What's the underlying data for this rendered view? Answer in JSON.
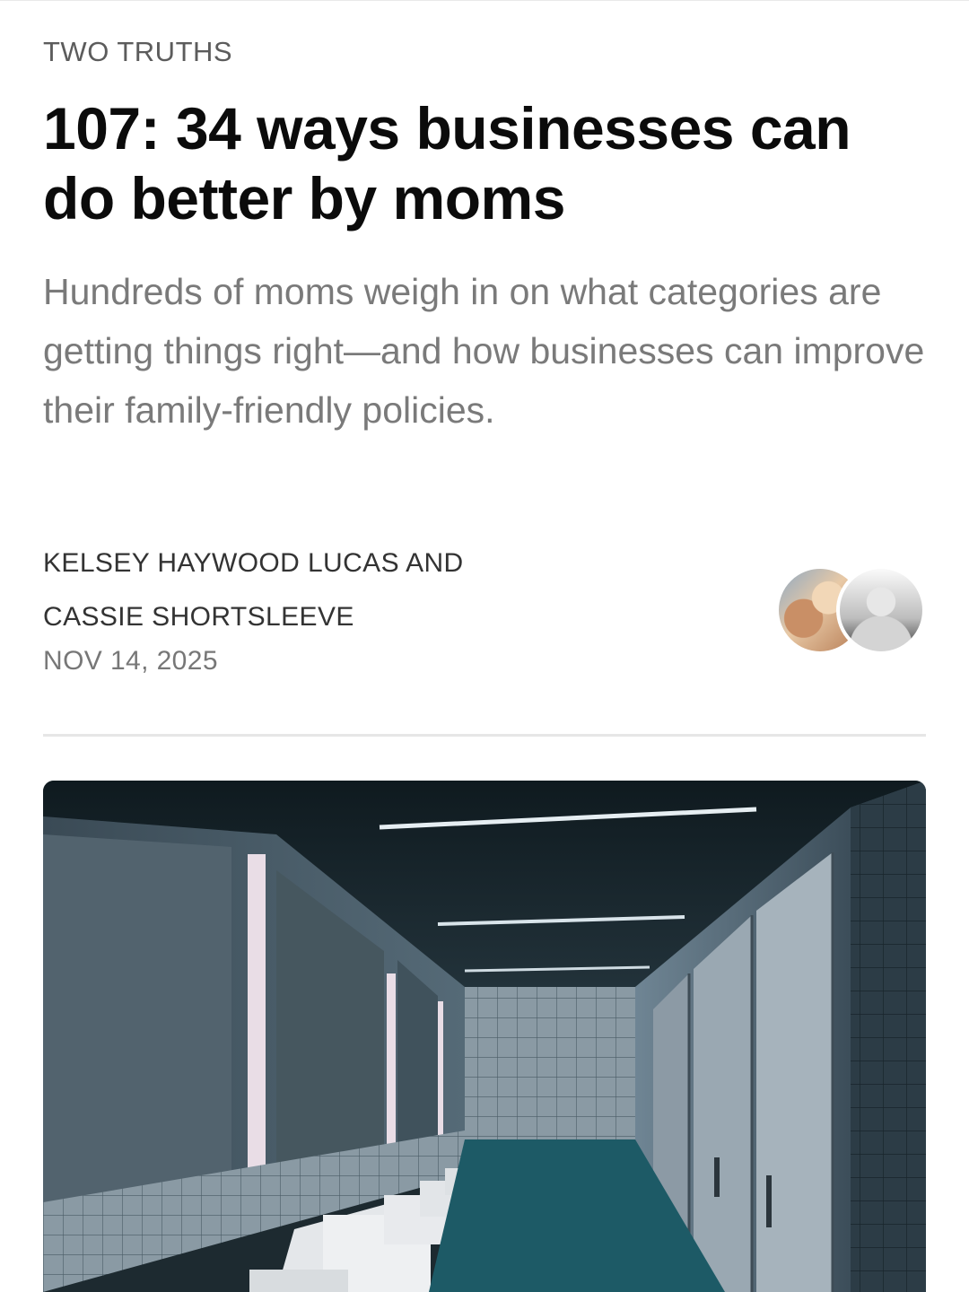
{
  "article": {
    "section": "TWO TRUTHS",
    "title": "107: 34 ways businesses can do better by moms",
    "subtitle": "Hundreds of moms weigh in on what categories are getting things right—and how businesses can improve their family-friendly policies.",
    "authors_line_1": "KELSEY HAYWOOD LUCAS AND",
    "authors_line_2": "CASSIE SHORTSLEEVE",
    "date": "NOV 14, 2025"
  },
  "hero_image": {
    "subject": "public restroom with mirrors, sinks and stalls"
  }
}
